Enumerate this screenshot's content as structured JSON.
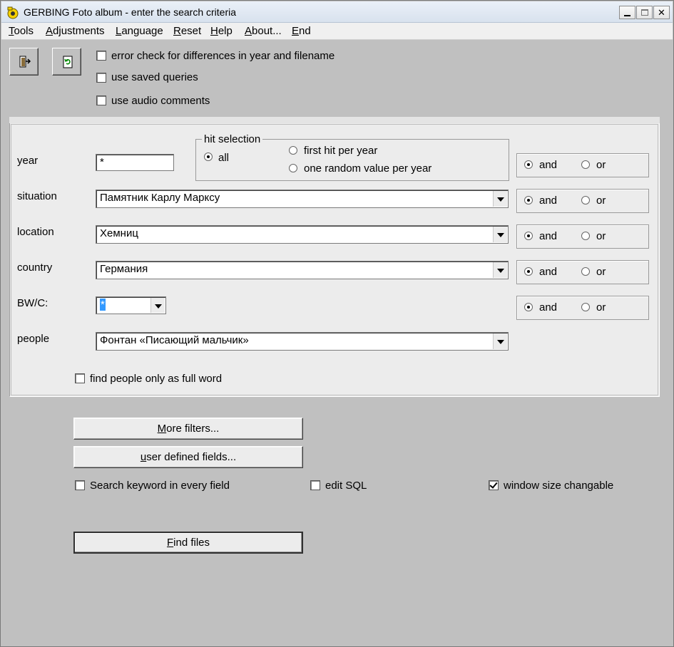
{
  "window": {
    "title": "GERBING Foto album - enter the search criteria",
    "controls": {
      "close_glyph": "✕"
    }
  },
  "menu": [
    {
      "accel": "T",
      "rest": "ools"
    },
    {
      "accel": "A",
      "rest": "djustments"
    },
    {
      "accel": "L",
      "rest": "anguage"
    },
    {
      "accel": "R",
      "rest": "eset"
    },
    {
      "accel": "H",
      "rest": "elp"
    },
    {
      "accel": "A",
      "rest": "bout..."
    },
    {
      "accel": "E",
      "rest": "nd"
    }
  ],
  "toolbar": {
    "icons": [
      "exit-door-icon",
      "refresh-icon"
    ]
  },
  "options": {
    "error_check": {
      "label": "error check for differences in year and filename",
      "checked": false
    },
    "saved_queries": {
      "label": "use saved queries",
      "checked": false
    },
    "audio_comments": {
      "label": "use audio comments",
      "checked": false
    }
  },
  "criteria": {
    "year": {
      "label": "year",
      "value": "*"
    },
    "hit_selection": {
      "title": "hit selection",
      "all": "all",
      "first_hit": "first hit per year",
      "random": "one random value per year",
      "selected": "all"
    },
    "situation": {
      "label": "situation",
      "value": "Памятник Карлу Марксу"
    },
    "location": {
      "label": "location",
      "value": "Хемниц"
    },
    "country": {
      "label": "country",
      "value": "Германия"
    },
    "bwc": {
      "label": "BW/C:",
      "value": "*"
    },
    "people": {
      "label": "people",
      "value": "Фонтан «Писающий мальчик»"
    },
    "logic": {
      "and": "and",
      "or": "or",
      "selected": "and"
    },
    "full_word": {
      "label": "find people only as full word",
      "checked": false
    }
  },
  "buttons": {
    "more_filters": {
      "accel": "M",
      "rest": "ore filters..."
    },
    "user_fields": {
      "accel": "u",
      "rest": "ser defined fields..."
    },
    "find_files": {
      "accel": "F",
      "rest": "ind files"
    }
  },
  "bottom_options": {
    "search_keyword": {
      "label": "Search keyword in every field",
      "checked": false
    },
    "edit_sql": {
      "label": "edit SQL",
      "checked": false
    },
    "window_size": {
      "label": "window size changable",
      "checked": true
    }
  }
}
